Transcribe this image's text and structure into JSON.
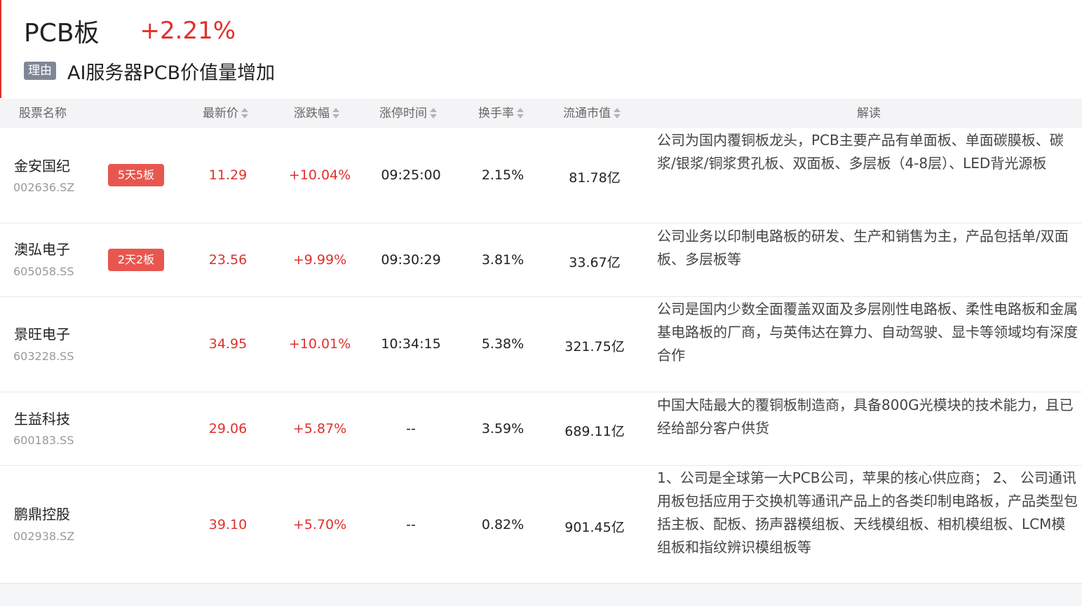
{
  "sector": {
    "name": "PCB板",
    "change": "+2.21%"
  },
  "reason": {
    "tag": "理由",
    "text": "AI服务器PCB价值量增加"
  },
  "columns": {
    "name": "股票名称",
    "price": "最新价",
    "change": "涨跌幅",
    "limit_time": "涨停时间",
    "turnover": "换手率",
    "market_cap": "流通市值",
    "desc": "解读"
  },
  "rows": [
    {
      "name": "金安国纪",
      "code": "002636.SZ",
      "badge": "5天5板",
      "price": "11.29",
      "change": "+10.04%",
      "limit_time": "09:25:00",
      "turnover": "2.15%",
      "market_cap": "81.78亿",
      "desc": "公司为国内覆铜板龙头，PCB主要产品有单面板、单面碳膜板、碳浆/银浆/铜浆贯孔板、双面板、多层板（4-8层）、LED背光源板"
    },
    {
      "name": "澳弘电子",
      "code": "605058.SS",
      "badge": "2天2板",
      "price": "23.56",
      "change": "+9.99%",
      "limit_time": "09:30:29",
      "turnover": "3.81%",
      "market_cap": "33.67亿",
      "desc": "公司业务以印制电路板的研发、生产和销售为主，产品包括单/双面板、多层板等"
    },
    {
      "name": "景旺电子",
      "code": "603228.SS",
      "badge": "",
      "price": "34.95",
      "change": "+10.01%",
      "limit_time": "10:34:15",
      "turnover": "5.38%",
      "market_cap": "321.75亿",
      "desc": "公司是国内少数全面覆盖双面及多层刚性电路板、柔性电路板和金属基电路板的厂商，与英伟达在算力、自动驾驶、显卡等领域均有深度合作"
    },
    {
      "name": "生益科技",
      "code": "600183.SS",
      "badge": "",
      "price": "29.06",
      "change": "+5.87%",
      "limit_time": "--",
      "turnover": "3.59%",
      "market_cap": "689.11亿",
      "desc": "中国大陆最大的覆铜板制造商，具备800G光模块的技术能力，且已经给部分客户供货"
    },
    {
      "name": "鹏鼎控股",
      "code": "002938.SZ",
      "badge": "",
      "price": "39.10",
      "change": "+5.70%",
      "limit_time": "--",
      "turnover": "0.82%",
      "market_cap": "901.45亿",
      "desc": "1、公司是全球第一大PCB公司，苹果的核心供应商； 2、 公司通讯用板包括应用于交换机等通讯产品上的各类印制电路板，产品类型包括主板、配板、扬声器模组板、天线模组板、相机模组板、LCM模组板和指纹辨识模组板等"
    }
  ],
  "colors": {
    "up": "#e0302c",
    "badge": "#e8574f",
    "tag": "#7f8797"
  }
}
